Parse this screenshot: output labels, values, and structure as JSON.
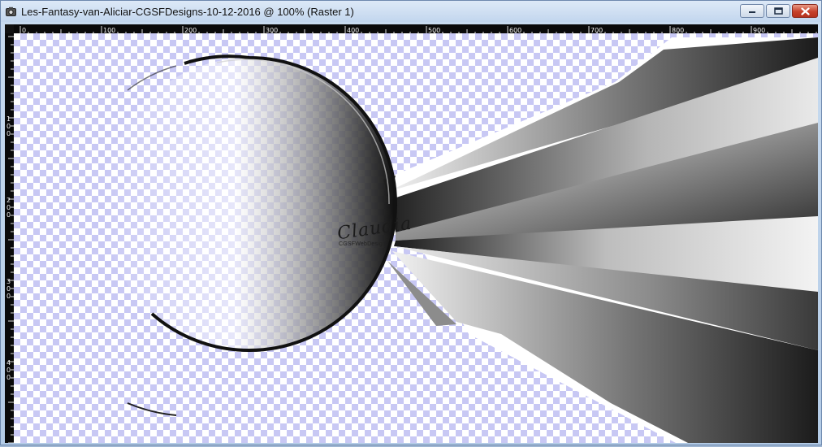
{
  "window": {
    "title": "Les-Fantasy-van-Aliciar-CGSFDesigns-10-12-2016 @ 100% (Raster 1)"
  },
  "icons": {
    "app": "camera-icon",
    "minimize": "minimize-icon",
    "maximize": "maximize-icon",
    "close": "close-icon"
  },
  "ruler": {
    "top_labels": [
      "0",
      "100",
      "200",
      "300",
      "400",
      "500",
      "600",
      "700",
      "800",
      "900"
    ],
    "left_labels": [
      "1",
      "0",
      "0",
      "2",
      "0",
      "0",
      "3",
      "0",
      "0",
      "4",
      "0",
      "0"
    ]
  },
  "canvas": {
    "signature": "Claudia",
    "signature_sub": "CGSFWebDesign",
    "checker_color": "#c8c8f4"
  },
  "colors": {
    "title_bar": "#c2d6ee",
    "close_button": "#c6402a",
    "ruler": "#0a0a0a"
  }
}
